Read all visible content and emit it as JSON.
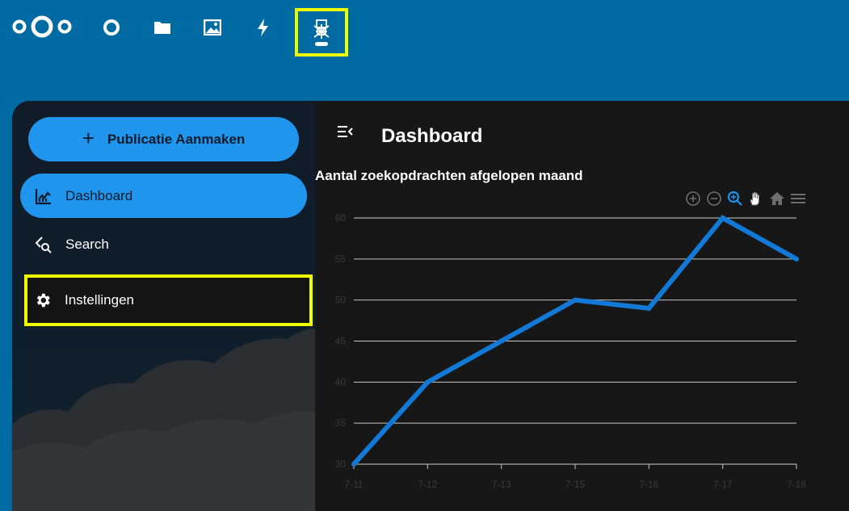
{
  "topbar": {
    "logo": "nextcloud-logo",
    "apps": [
      {
        "icon": "dashboard-circle-icon",
        "label": "Dashboard"
      },
      {
        "icon": "folder-icon",
        "label": "Files"
      },
      {
        "icon": "image-icon",
        "label": "Photos"
      },
      {
        "icon": "lightning-icon",
        "label": "Activity"
      },
      {
        "icon": "opencatalogi-app-icon",
        "label": "Open Catalogi",
        "highlighted": true
      }
    ]
  },
  "sidebar": {
    "create_button": {
      "icon": "plus-icon",
      "label": "Publicatie Aanmaken"
    },
    "items": [
      {
        "icon": "chart-line-icon",
        "label": "Dashboard",
        "active": true
      },
      {
        "icon": "search-icon",
        "label": "Search",
        "active": false
      },
      {
        "icon": "gear-icon",
        "label": "Instellingen",
        "active": false,
        "highlighted": true
      }
    ]
  },
  "main": {
    "toggle_icon": "menu-collapse-icon",
    "title": "Dashboard"
  },
  "chart_toolbar": [
    "zoom-in-icon",
    "zoom-out-icon",
    "selection-zoom-icon",
    "pan-hand-icon",
    "reset-home-icon",
    "menu-icon"
  ],
  "chart_data": {
    "type": "line",
    "title": "Aantal zoekopdrachten afgelopen maand",
    "categories": [
      "7-11",
      "7-12",
      "7-13",
      "7-15",
      "7-16",
      "7-17",
      "7-18"
    ],
    "series": [
      {
        "values": [
          30,
          40,
          45,
          50,
          49,
          60,
          55
        ]
      }
    ],
    "ylim": [
      30,
      60
    ],
    "yticks": [
      60,
      55,
      50,
      45,
      40,
      35,
      30
    ],
    "grid": true,
    "xlabel": "",
    "ylabel": "",
    "colors": {
      "line": "#1279d6",
      "grid": "#c8c8c8",
      "tick_text": "#3a3a3a",
      "active_tool": "#1f95ee"
    }
  },
  "colors": {
    "header": "#006aa3",
    "accent": "#1f95ee",
    "highlight": "#f0ff00"
  }
}
